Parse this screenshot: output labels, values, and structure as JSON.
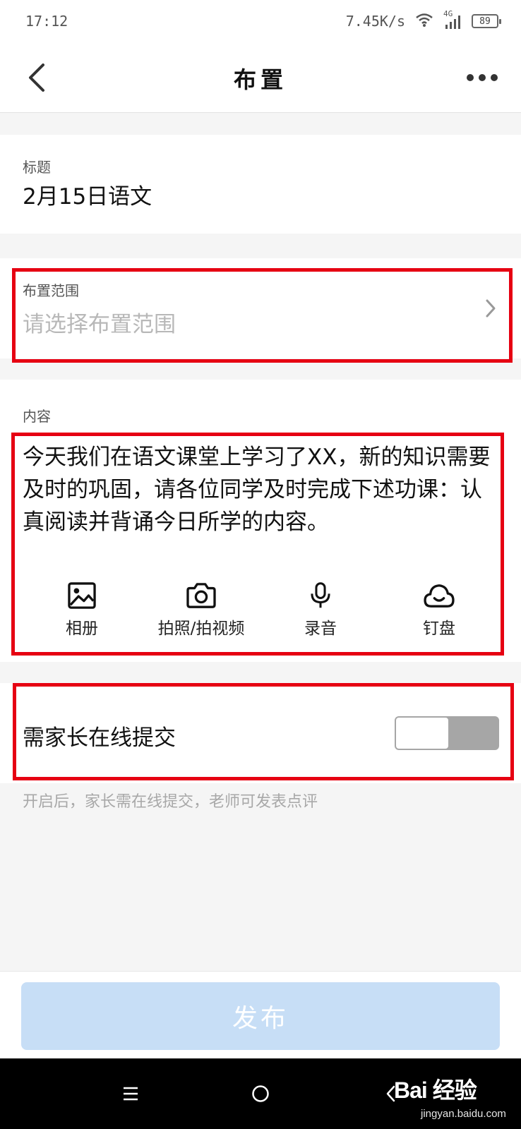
{
  "status_bar": {
    "time": "17:12",
    "network_speed": "7.45K/s",
    "signal_type": "4G",
    "battery_level": "89"
  },
  "header": {
    "title": "布置",
    "back_icon": "chevron-left-icon",
    "more_icon": "more-horizontal-icon"
  },
  "title_field": {
    "label": "标题",
    "value": "2月15日语文"
  },
  "scope_field": {
    "label": "布置范围",
    "placeholder": "请选择布置范围"
  },
  "content_field": {
    "label": "内容",
    "value": "今天我们在语文课堂上学习了XX，新的知识需要及时的巩固，请各位同学及时完成下述功课：认真阅读并背诵今日所学的内容。"
  },
  "toolbar": {
    "items": [
      {
        "label": "相册",
        "icon": "image-icon"
      },
      {
        "label": "拍照/拍视频",
        "icon": "camera-icon"
      },
      {
        "label": "录音",
        "icon": "microphone-icon"
      },
      {
        "label": "钉盘",
        "icon": "cloud-icon"
      }
    ]
  },
  "online_submit": {
    "label": "需家长在线提交",
    "enabled": false,
    "hint": "开启后，家长需在线提交，老师可发表点评"
  },
  "publish_button": {
    "label": "发布"
  },
  "watermark": {
    "main": "Bai 经验",
    "sub": "jingyan.baidu.com"
  },
  "colors": {
    "highlight": "#e60012",
    "publish_disabled": "#c7def6",
    "toggle_off": "#a6a6a6"
  }
}
